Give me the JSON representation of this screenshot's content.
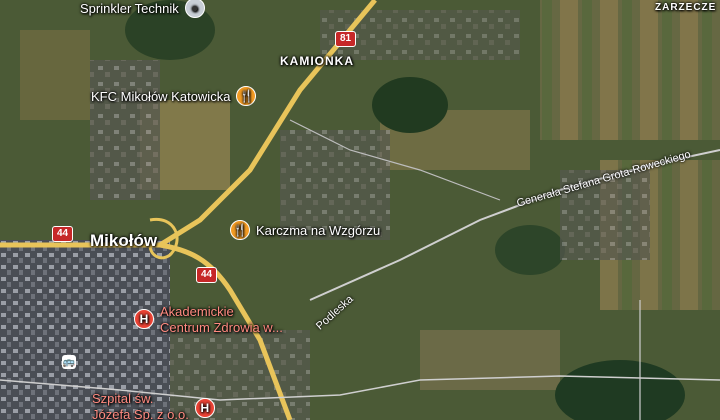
{
  "places": {
    "kamionka": "KAMIONKA",
    "zarzecze": "ZARZECZE",
    "mikolow": "Mikołów"
  },
  "pois": {
    "sprinkler": "Sprinkler Technik",
    "kfc": "KFC Mikołów Katowicka",
    "karczma": "Karczma na Wzgórzu",
    "akademickie_line1": "Akademickie",
    "akademickie_line2": "Centrum Zdrowia w...",
    "szpital_line1": "Szpital św.",
    "szpital_line2": "Józefa Sp. z o.o."
  },
  "roads": {
    "route_81": "81",
    "route_44_west": "44",
    "route_44_center": "44",
    "street_grota": "Generała Stefana Grota-Roweckiego",
    "street_podleska": "Podleska"
  },
  "icons": {
    "restaurant": "🍴",
    "hospital": "H",
    "place_pin": "●",
    "bus": "🚌"
  },
  "colors": {
    "route_shield": "#c62828",
    "restaurant_marker": "#f29b24",
    "hospital_marker": "#ea4335",
    "highway": "#e8c45a"
  }
}
